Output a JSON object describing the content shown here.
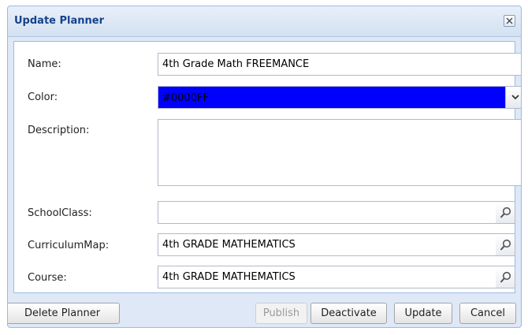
{
  "dialog": {
    "title": "Update Planner"
  },
  "form": {
    "name_label": "Name:",
    "name_value": "4th Grade Math FREEMANCE",
    "color_label": "Color:",
    "color_value": "#0000FF",
    "color_swatch": "#0000ff",
    "description_label": "Description:",
    "description_value": "",
    "schoolclass_label": "SchoolClass:",
    "schoolclass_value": "",
    "curriculummap_label": "CurriculumMap:",
    "curriculummap_value": "4th GRADE MATHEMATICS",
    "course_label": "Course:",
    "course_value": "4th GRADE MATHEMATICS"
  },
  "footer": {
    "delete_label": "Delete Planner",
    "publish_label": "Publish",
    "deactivate_label": "Deactivate",
    "update_label": "Update",
    "cancel_label": "Cancel"
  },
  "colors": {
    "title_text": "#15428b",
    "panel_border": "#99bbe8",
    "dialog_bg": "#dfe8f6"
  }
}
